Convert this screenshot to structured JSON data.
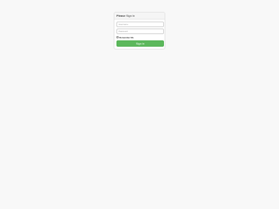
{
  "login": {
    "heading_strong": "Please",
    "heading_rest": "Sign In",
    "username_placeholder": "Username",
    "username_value": "",
    "password_placeholder": "Password",
    "password_value": "",
    "remember_label": "Remember Me",
    "remember_checked": false,
    "signin_label": "Sign in"
  },
  "colors": {
    "background": "#f8f8f8",
    "signin_button": "#5cb85c",
    "panel_heading": "#f5f5f5"
  }
}
